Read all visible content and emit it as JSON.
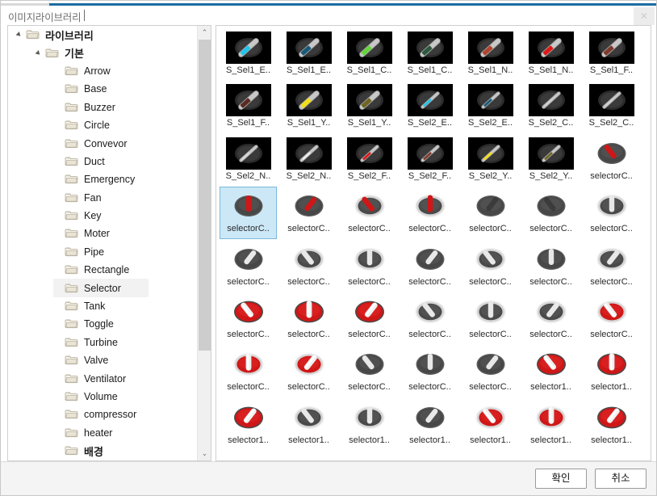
{
  "window": {
    "title": "이미지라이브러리",
    "close_label": "✕"
  },
  "tree": {
    "items": [
      {
        "label": "라이브러리",
        "depth": 0,
        "expander": "open",
        "korean": true,
        "selected": false
      },
      {
        "label": "기본",
        "depth": 1,
        "expander": "open",
        "korean": true,
        "selected": false
      },
      {
        "label": "Arrow",
        "depth": 2,
        "expander": "none",
        "korean": false,
        "selected": false
      },
      {
        "label": "Base",
        "depth": 2,
        "expander": "none",
        "korean": false,
        "selected": false
      },
      {
        "label": "Buzzer",
        "depth": 2,
        "expander": "none",
        "korean": false,
        "selected": false
      },
      {
        "label": "Circle",
        "depth": 2,
        "expander": "none",
        "korean": false,
        "selected": false
      },
      {
        "label": "Convevor",
        "depth": 2,
        "expander": "none",
        "korean": false,
        "selected": false
      },
      {
        "label": "Duct",
        "depth": 2,
        "expander": "none",
        "korean": false,
        "selected": false
      },
      {
        "label": "Emergency",
        "depth": 2,
        "expander": "none",
        "korean": false,
        "selected": false
      },
      {
        "label": "Fan",
        "depth": 2,
        "expander": "none",
        "korean": false,
        "selected": false
      },
      {
        "label": "Key",
        "depth": 2,
        "expander": "none",
        "korean": false,
        "selected": false
      },
      {
        "label": "Moter",
        "depth": 2,
        "expander": "none",
        "korean": false,
        "selected": false
      },
      {
        "label": "Pipe",
        "depth": 2,
        "expander": "none",
        "korean": false,
        "selected": false
      },
      {
        "label": "Rectangle",
        "depth": 2,
        "expander": "none",
        "korean": false,
        "selected": false
      },
      {
        "label": "Selector",
        "depth": 2,
        "expander": "none",
        "korean": false,
        "selected": true
      },
      {
        "label": "Tank",
        "depth": 2,
        "expander": "none",
        "korean": false,
        "selected": false
      },
      {
        "label": "Toggle",
        "depth": 2,
        "expander": "none",
        "korean": false,
        "selected": false
      },
      {
        "label": "Turbine",
        "depth": 2,
        "expander": "none",
        "korean": false,
        "selected": false
      },
      {
        "label": "Valve",
        "depth": 2,
        "expander": "none",
        "korean": false,
        "selected": false
      },
      {
        "label": "Ventilator",
        "depth": 2,
        "expander": "none",
        "korean": false,
        "selected": false
      },
      {
        "label": "Volume",
        "depth": 2,
        "expander": "none",
        "korean": false,
        "selected": false
      },
      {
        "label": "compressor",
        "depth": 2,
        "expander": "none",
        "korean": false,
        "selected": false
      },
      {
        "label": "heater",
        "depth": 2,
        "expander": "none",
        "korean": false,
        "selected": false
      },
      {
        "label": "배경",
        "depth": 2,
        "expander": "none",
        "korean": true,
        "selected": false
      }
    ],
    "scrollbar": {
      "up_glyph": "⌃",
      "down_glyph": "⌄",
      "thumb_top_pct": 10,
      "thumb_height_pct": 68
    }
  },
  "grid": {
    "items": [
      {
        "label": "S_Sel1_E..",
        "style": "dark",
        "knob": "bar",
        "accent": "#23c4ec",
        "angle": -42,
        "selected": false
      },
      {
        "label": "S_Sel1_E..",
        "style": "dark",
        "knob": "bar",
        "accent": "#17597a",
        "angle": -42,
        "selected": false
      },
      {
        "label": "S_Sel1_C..",
        "style": "dark",
        "knob": "bar",
        "accent": "#63d63a",
        "angle": -42,
        "selected": false
      },
      {
        "label": "S_Sel1_C..",
        "style": "dark",
        "knob": "bar",
        "accent": "#2d5a3f",
        "angle": -42,
        "selected": false
      },
      {
        "label": "S_Sel1_N..",
        "style": "dark",
        "knob": "bar",
        "accent": "#b1442f",
        "angle": -42,
        "selected": false
      },
      {
        "label": "S_Sel1_N..",
        "style": "dark",
        "knob": "bar",
        "accent": "#e01818",
        "angle": -42,
        "selected": false
      },
      {
        "label": "S_Sel1_F..",
        "style": "dark",
        "knob": "bar",
        "accent": "#7e3a2c",
        "angle": -42,
        "selected": false
      },
      {
        "label": "S_Sel1_F..",
        "style": "dark",
        "knob": "bar",
        "accent": "#5b2a20",
        "angle": -42,
        "selected": false
      },
      {
        "label": "S_Sel1_Y..",
        "style": "dark",
        "knob": "bar",
        "accent": "#f2e113",
        "angle": -42,
        "selected": false
      },
      {
        "label": "S_Sel1_Y..",
        "style": "dark",
        "knob": "bar",
        "accent": "#6e6523",
        "angle": -42,
        "selected": false
      },
      {
        "label": "S_Sel2_E..",
        "style": "dark",
        "knob": "slim",
        "accent": "#23c4ec",
        "angle": -42,
        "selected": false
      },
      {
        "label": "S_Sel2_E..",
        "style": "dark",
        "knob": "slim",
        "accent": "#17597a",
        "angle": -42,
        "selected": false
      },
      {
        "label": "S_Sel2_C..",
        "style": "dark",
        "knob": "slim",
        "accent": "#cfcfcf",
        "angle": -42,
        "selected": false
      },
      {
        "label": "S_Sel2_C..",
        "style": "dark",
        "knob": "slim",
        "accent": "#cfcfcf",
        "angle": -42,
        "selected": false
      },
      {
        "label": "S_Sel2_N..",
        "style": "dark",
        "knob": "slim",
        "accent": "#d8d8d8",
        "angle": -42,
        "selected": false
      },
      {
        "label": "S_Sel2_N..",
        "style": "dark",
        "knob": "slim",
        "accent": "#ededed",
        "angle": -42,
        "selected": false
      },
      {
        "label": "S_Sel2_F..",
        "style": "dark",
        "knob": "slim",
        "accent": "#e01818",
        "angle": -42,
        "selected": false
      },
      {
        "label": "S_Sel2_F..",
        "style": "dark",
        "knob": "slim",
        "accent": "#7e3a2c",
        "angle": -42,
        "selected": false
      },
      {
        "label": "S_Sel2_Y..",
        "style": "dark",
        "knob": "slim",
        "accent": "#f2e113",
        "angle": -42,
        "selected": false
      },
      {
        "label": "S_Sel2_Y..",
        "style": "dark",
        "knob": "slim",
        "accent": "#6e6523",
        "angle": -42,
        "selected": false
      },
      {
        "label": "selectorC..",
        "style": "light",
        "knob": "dial-dark",
        "accent": "#d01616",
        "angle": -38,
        "selected": false
      },
      {
        "label": "selectorC..",
        "style": "light",
        "knob": "dial-dark",
        "accent": "#d01616",
        "angle": 0,
        "selected": true
      },
      {
        "label": "selectorC..",
        "style": "light",
        "knob": "dial-dark",
        "accent": "#d01616",
        "angle": 38,
        "selected": false
      },
      {
        "label": "selectorC..",
        "style": "light",
        "knob": "dial-ring",
        "accent": "#d01616",
        "angle": -38,
        "selected": false
      },
      {
        "label": "selectorC..",
        "style": "light",
        "knob": "dial-ring",
        "accent": "#d01616",
        "angle": 0,
        "selected": false
      },
      {
        "label": "selectorC..",
        "style": "light",
        "knob": "dial-dark",
        "accent": "#3b3b3b",
        "angle": 38,
        "selected": false
      },
      {
        "label": "selectorC..",
        "style": "light",
        "knob": "dial-dark",
        "accent": "#3b3b3b",
        "angle": -38,
        "selected": false
      },
      {
        "label": "selectorC..",
        "style": "light",
        "knob": "dial-ring",
        "accent": "#e8e8e8",
        "angle": 0,
        "selected": false
      },
      {
        "label": "selectorC..",
        "style": "light",
        "knob": "dial-dark",
        "accent": "#e8e8e8",
        "angle": 38,
        "selected": false
      },
      {
        "label": "selectorC..",
        "style": "light",
        "knob": "dial-ring",
        "accent": "#e8e8e8",
        "angle": -38,
        "selected": false
      },
      {
        "label": "selectorC..",
        "style": "light",
        "knob": "dial-ring",
        "accent": "#e8e8e8",
        "angle": 0,
        "selected": false
      },
      {
        "label": "selectorC..",
        "style": "light",
        "knob": "dial-dark",
        "accent": "#e8e8e8",
        "angle": 38,
        "selected": false
      },
      {
        "label": "selectorC..",
        "style": "light",
        "knob": "dial-ring",
        "accent": "#e8e8e8",
        "angle": -38,
        "selected": false
      },
      {
        "label": "selectorC..",
        "style": "light",
        "knob": "dial-dark",
        "accent": "#e8e8e8",
        "angle": 0,
        "selected": false
      },
      {
        "label": "selectorC..",
        "style": "light",
        "knob": "dial-ring",
        "accent": "#e8e8e8",
        "angle": 38,
        "selected": false
      },
      {
        "label": "selectorC..",
        "style": "light",
        "knob": "dial-red",
        "accent": "#ffffff",
        "angle": -38,
        "selected": false
      },
      {
        "label": "selectorC..",
        "style": "light",
        "knob": "dial-red",
        "accent": "#ffffff",
        "angle": 0,
        "selected": false
      },
      {
        "label": "selectorC..",
        "style": "light",
        "knob": "dial-red",
        "accent": "#ffffff",
        "angle": 38,
        "selected": false
      },
      {
        "label": "selectorC..",
        "style": "light",
        "knob": "dial-ring",
        "accent": "#e8e8e8",
        "angle": -38,
        "selected": false
      },
      {
        "label": "selectorC..",
        "style": "light",
        "knob": "dial-ring",
        "accent": "#e8e8e8",
        "angle": 0,
        "selected": false
      },
      {
        "label": "selectorC..",
        "style": "light",
        "knob": "dial-ring",
        "accent": "#e8e8e8",
        "angle": 38,
        "selected": false
      },
      {
        "label": "selectorC..",
        "style": "light",
        "knob": "dial-redring",
        "accent": "#ffffff",
        "angle": -38,
        "selected": false
      },
      {
        "label": "selectorC..",
        "style": "light",
        "knob": "dial-redring",
        "accent": "#ffffff",
        "angle": 0,
        "selected": false
      },
      {
        "label": "selectorC..",
        "style": "light",
        "knob": "dial-redring",
        "accent": "#ffffff",
        "angle": 38,
        "selected": false
      },
      {
        "label": "selectorC..",
        "style": "light",
        "knob": "dial-dark",
        "accent": "#e8e8e8",
        "angle": -38,
        "selected": false
      },
      {
        "label": "selectorC..",
        "style": "light",
        "knob": "dial-dark",
        "accent": "#e8e8e8",
        "angle": 0,
        "selected": false
      },
      {
        "label": "selectorC..",
        "style": "light",
        "knob": "dial-dark",
        "accent": "#e8e8e8",
        "angle": 38,
        "selected": false
      },
      {
        "label": "selector1..",
        "style": "light",
        "knob": "dial-red",
        "accent": "#ffffff",
        "angle": -38,
        "selected": false
      },
      {
        "label": "selector1..",
        "style": "light",
        "knob": "dial-red",
        "accent": "#ffffff",
        "angle": 0,
        "selected": false
      },
      {
        "label": "selector1..",
        "style": "light",
        "knob": "dial-red",
        "accent": "#ffffff",
        "angle": 38,
        "selected": false
      },
      {
        "label": "selector1..",
        "style": "light",
        "knob": "dial-ring",
        "accent": "#e8e8e8",
        "angle": -38,
        "selected": false
      },
      {
        "label": "selector1..",
        "style": "light",
        "knob": "dial-ring",
        "accent": "#e8e8e8",
        "angle": 0,
        "selected": false
      },
      {
        "label": "selector1..",
        "style": "light",
        "knob": "dial-dark",
        "accent": "#e8e8e8",
        "angle": 38,
        "selected": false
      },
      {
        "label": "selector1..",
        "style": "light",
        "knob": "dial-redring",
        "accent": "#ffffff",
        "angle": -38,
        "selected": false
      },
      {
        "label": "selector1..",
        "style": "light",
        "knob": "dial-redring",
        "accent": "#ffffff",
        "angle": 0,
        "selected": false
      },
      {
        "label": "selector1..",
        "style": "light",
        "knob": "dial-red",
        "accent": "#ffffff",
        "angle": 38,
        "selected": false
      }
    ]
  },
  "footer": {
    "ok_label": "확인",
    "cancel_label": "취소"
  },
  "colors": {
    "accent_bar": "#1d6ca4",
    "selection_bg": "#cce8f7",
    "selection_border": "#7bb8dc",
    "tree_selection_bg": "#f2f2f2"
  }
}
